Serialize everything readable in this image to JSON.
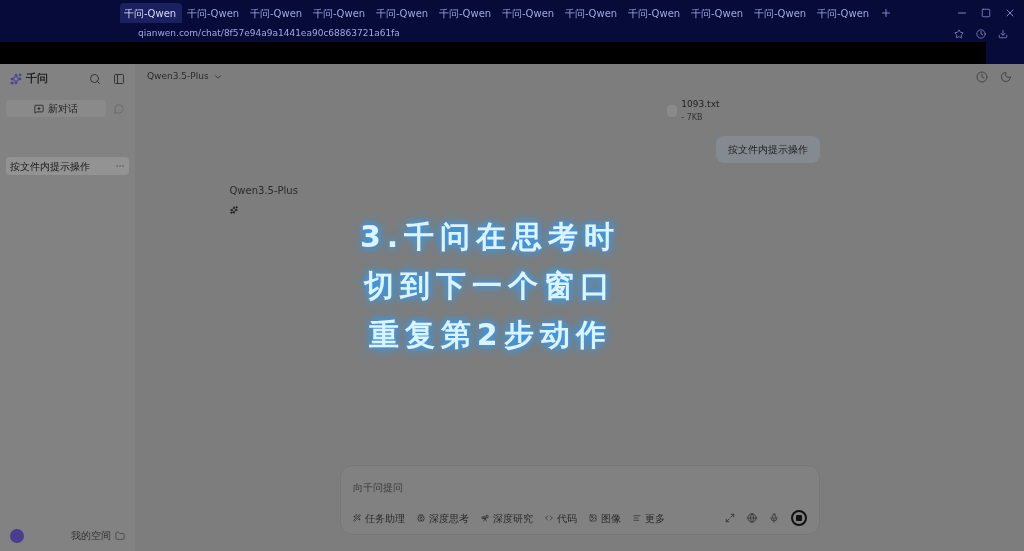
{
  "browser": {
    "tabs": [
      {
        "label": "千问-Qwen",
        "selected": true
      },
      {
        "label": "千问-Qwen",
        "selected": false
      },
      {
        "label": "千问-Qwen",
        "selected": false
      },
      {
        "label": "千问-Qwen",
        "selected": false
      },
      {
        "label": "千问-Qwen",
        "selected": false
      },
      {
        "label": "千问-Qwen",
        "selected": false
      },
      {
        "label": "千问-Qwen",
        "selected": false
      },
      {
        "label": "千问-Qwen",
        "selected": false
      },
      {
        "label": "千问-Qwen",
        "selected": false
      },
      {
        "label": "千问-Qwen",
        "selected": false
      },
      {
        "label": "千问-Qwen",
        "selected": false
      },
      {
        "label": "千问-Qwen",
        "selected": false
      }
    ],
    "url": "qianwen.com/chat/8f57e94a9a1441ea90c68863721a61fa"
  },
  "sidebar": {
    "logo": "千问",
    "new_chat": "新对话",
    "history": [
      {
        "label": "按文件内提示操作",
        "selected": true
      }
    ],
    "footer": "我的空间"
  },
  "header": {
    "model": "Qwen3.5-Plus"
  },
  "messages": [
    {
      "kind": "file",
      "name": "1093.txt",
      "size": "- 7KB"
    },
    {
      "kind": "user",
      "text": "按文件内提示操作"
    },
    {
      "kind": "assistant",
      "model": "Qwen3.5-Plus"
    }
  ],
  "composer": {
    "placeholder": "向千问提问",
    "tools": [
      "任务助理",
      "深度思考",
      "深度研究",
      "代码",
      "图像",
      "更多"
    ]
  },
  "caption": [
    "3.千问在思考时",
    "切到下一个窗口",
    "重复第2步动作"
  ]
}
